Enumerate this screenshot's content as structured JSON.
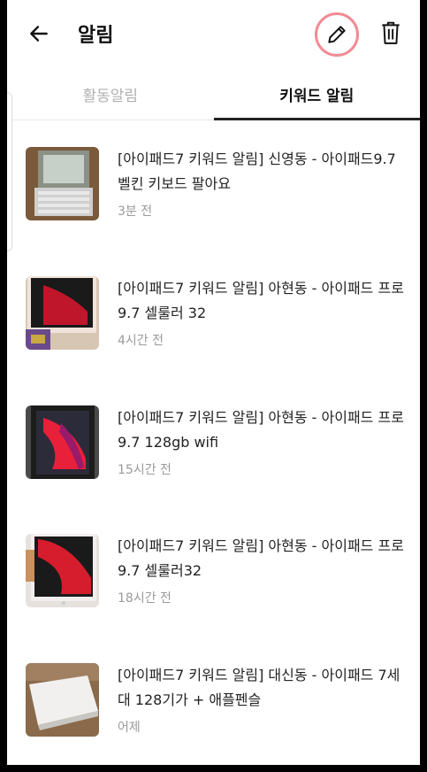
{
  "header": {
    "title": "알림",
    "back_icon": "arrow-left-icon",
    "edit_icon": "pencil-icon",
    "delete_icon": "trash-icon",
    "edit_highlight_color": "#f28b94"
  },
  "tabs": [
    {
      "label": "활동알림",
      "active": false
    },
    {
      "label": "키워드 알림",
      "active": true
    }
  ],
  "notifications": [
    {
      "title": "[아이패드7 키워드 알림] 신영동 - 아이패드9.7 벨킨 키보드 팔아요",
      "time": "3분 전"
    },
    {
      "title": "[아이패드7 키워드 알림] 아현동 - 아이패드 프로9.7 셀룰러 32",
      "time": "4시간 전"
    },
    {
      "title": "[아이패드7 키워드 알림] 아현동 - 아이패드 프로 9.7 128gb wifi",
      "time": "15시간 전"
    },
    {
      "title": "[아이패드7 키워드 알림] 아현동 - 아이패드 프로 9.7 셀룰러32",
      "time": "18시간 전"
    },
    {
      "title": "[아이패드7 키워드 알림] 대신동 - 아이패드 7세대 128기가 + 애플펜슬",
      "time": "어제"
    }
  ]
}
